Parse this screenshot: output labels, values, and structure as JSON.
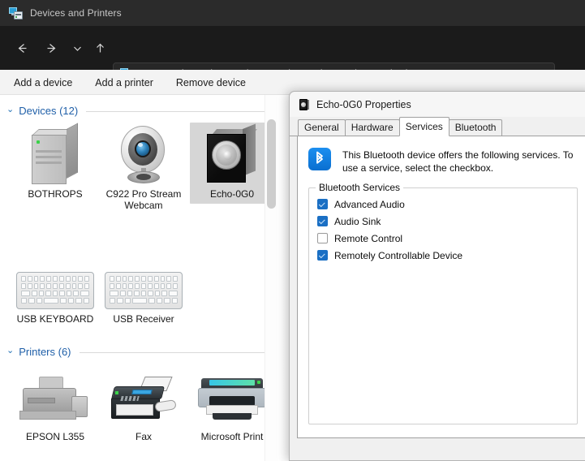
{
  "window": {
    "title": "Devices and Printers",
    "icon": "devices-and-printers-icon"
  },
  "nav": {
    "back": "back-arrow-icon",
    "forward": "forward-arrow-icon",
    "recent": "chevron-down-icon",
    "up": "up-arrow-icon"
  },
  "address": {
    "icon": "devices-and-printers-icon",
    "separator": "›",
    "crumbs": [
      "Control Panel",
      "Hardware and Sound",
      "Devices and Printers"
    ]
  },
  "command_bar": {
    "items": [
      "Add a device",
      "Add a printer",
      "Remove device"
    ]
  },
  "groups": [
    {
      "chevron": "⌄",
      "title": "Devices (12)",
      "items": [
        {
          "label": "BOTHROPS",
          "art": "pc-tower-icon",
          "selected": false
        },
        {
          "label": "C922 Pro Stream Webcam",
          "art": "webcam-icon",
          "selected": false
        },
        {
          "label": "Echo-0G0",
          "art": "speaker-icon",
          "selected": true
        },
        {
          "label": "USB KEYBOARD",
          "art": "keyboard-icon",
          "selected": false
        },
        {
          "label": "USB Receiver",
          "art": "keyboard-icon",
          "selected": false
        }
      ]
    },
    {
      "chevron": "⌄",
      "title": "Printers (6)",
      "items": [
        {
          "label": "EPSON L355",
          "art": "inkjet-printer-icon",
          "selected": false
        },
        {
          "label": "Fax",
          "art": "fax-machine-icon",
          "selected": false
        },
        {
          "label": "Microsoft Print",
          "art": "laser-printer-icon",
          "selected": false
        }
      ]
    }
  ],
  "dialog": {
    "icon": "speaker-device-icon",
    "title": "Echo-0G0 Properties",
    "tabs": [
      {
        "label": "General",
        "active": false
      },
      {
        "label": "Hardware",
        "active": false
      },
      {
        "label": "Services",
        "active": true
      },
      {
        "label": "Bluetooth",
        "active": false
      }
    ],
    "banner": {
      "icon": "bluetooth-icon",
      "text": "This Bluetooth device offers the following services. To use a service, select the checkbox."
    },
    "group": {
      "legend": "Bluetooth Services",
      "services": [
        {
          "label": "Advanced Audio",
          "checked": true
        },
        {
          "label": "Audio Sink",
          "checked": true
        },
        {
          "label": "Remote Control",
          "checked": false
        },
        {
          "label": "Remotely Controllable Device",
          "checked": true
        }
      ]
    }
  },
  "colors": {
    "accent_blue": "#1a6fc4",
    "group_title": "#1f5fa8",
    "titlebar": "#2b2b2b",
    "selection": "#d6d6d6"
  }
}
